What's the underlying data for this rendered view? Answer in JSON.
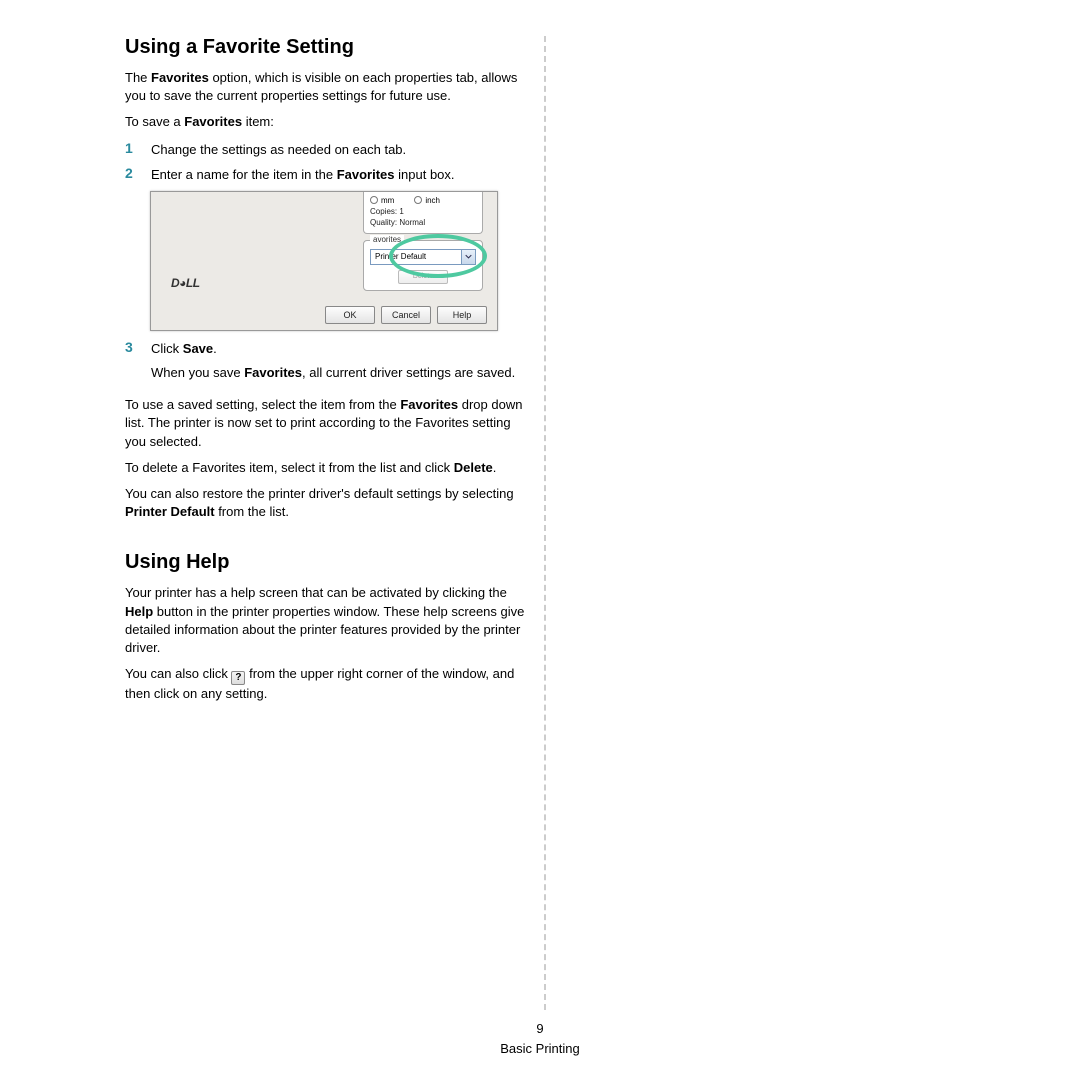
{
  "section1": {
    "heading": "Using a Favorite Setting",
    "p1_a": "The ",
    "p1_b": "Favorites",
    "p1_c": " option, which is visible on each properties tab, allows you to save the current properties settings for future use.",
    "p2_a": "To save a ",
    "p2_b": "Favorites",
    "p2_c": " item:",
    "step1": {
      "num": "1",
      "text": "Change the settings as needed on each tab."
    },
    "step2": {
      "num": "2",
      "text_a": "Enter a name for the item in the ",
      "text_b": "Favorites",
      "text_c": " input box."
    },
    "step3": {
      "num": "3",
      "text_a": "Click ",
      "text_b": "Save",
      "text_c": ".",
      "sub_a": "When you save ",
      "sub_b": "Favorites",
      "sub_c": ", all current driver settings are saved."
    },
    "p3_a": "To use a saved setting, select the item from the ",
    "p3_b": "Favorites",
    "p3_c": " drop down list. The printer is now set to print according to the Favorites setting you selected.",
    "p4_a": "To delete a Favorites item, select it from the list and click ",
    "p4_b": "Delete",
    "p4_c": ".",
    "p5_a": "You can also restore the printer driver's default settings by selecting ",
    "p5_b": "Printer Default",
    "p5_c": " from the list."
  },
  "screenshot": {
    "radio_mm": "mm",
    "radio_inch": "inch",
    "copies": "Copies: 1",
    "quality": "Quality: Normal",
    "fav_legend": "avorites",
    "fav_value": "Printer Default",
    "delete_btn": "Delete",
    "logo": "D◕LL",
    "ok": "OK",
    "cancel": "Cancel",
    "help": "Help"
  },
  "section2": {
    "heading": "Using Help",
    "p1_a": "Your printer has a help screen that can be activated by clicking the ",
    "p1_b": "Help",
    "p1_c": " button in the printer properties window. These help screens give detailed information about the printer features provided by the printer driver.",
    "p2_a": "You can also click ",
    "p2_b": " from the upper right corner of the window, and then click on any setting.",
    "help_glyph": "?"
  },
  "footer": {
    "page_num": "9",
    "label": "Basic Printing"
  }
}
